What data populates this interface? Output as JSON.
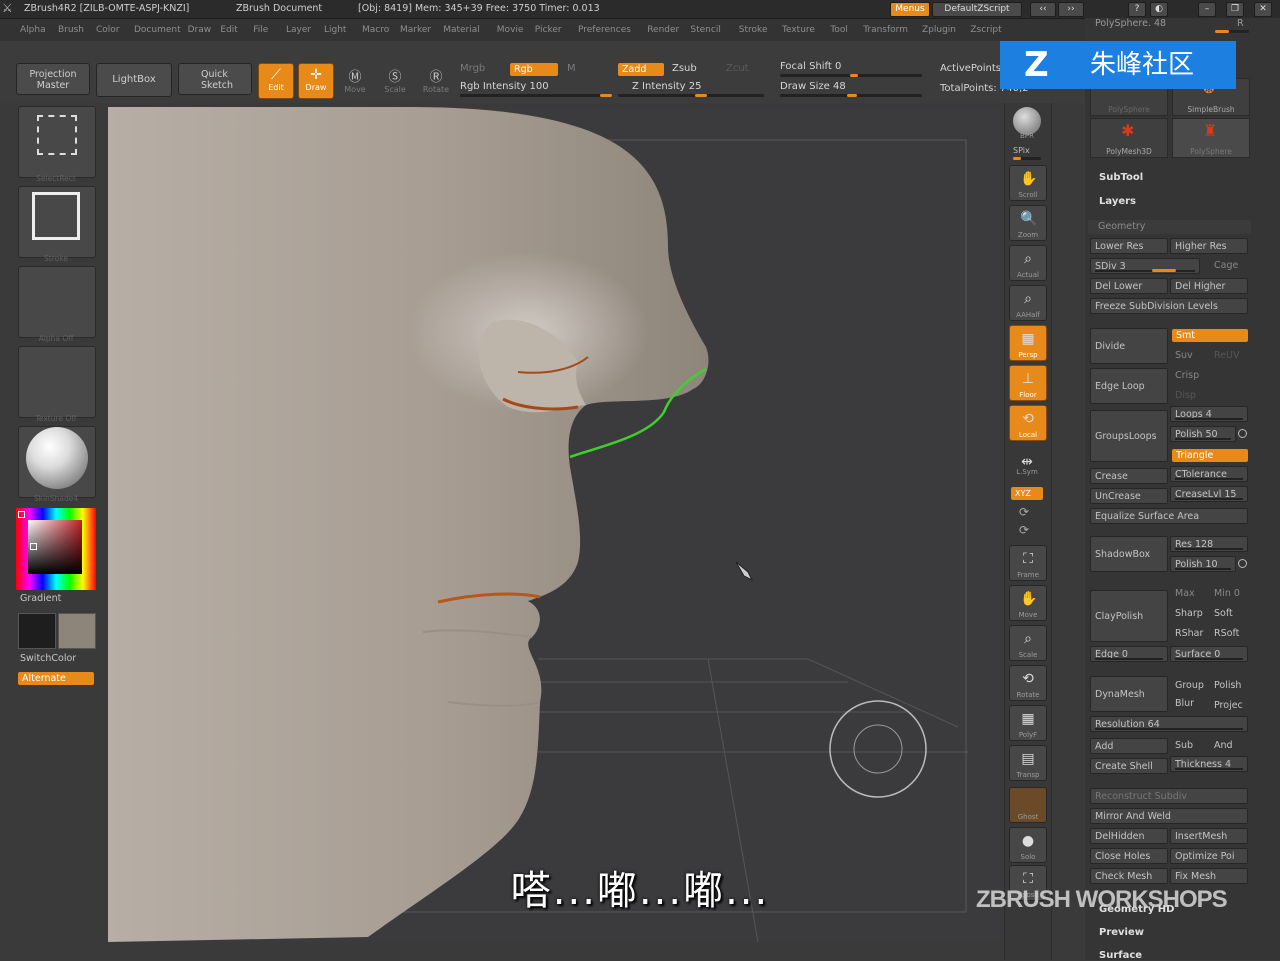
{
  "titlebar": {
    "app": "ZBrush4R2 [ZILB-OMTE-ASPJ-KNZI]",
    "doc": "ZBrush Document",
    "stats": "[Obj: 8419] Mem: 345+39 Free: 3750 Timer: 0.013",
    "menus_btn": "Menus",
    "script_btn": "DefaultZScript"
  },
  "menubar": [
    "Alpha",
    "Brush",
    "Color",
    "Document",
    "Draw",
    "Edit",
    "File",
    "Layer",
    "Light",
    "Macro",
    "Marker",
    "Material",
    "Movie",
    "Picker",
    "Preferences",
    "Render",
    "Stencil",
    "Stroke",
    "Texture",
    "Tool",
    "Transform",
    "Zplugin",
    "Zscript"
  ],
  "shelf": {
    "projection_master": "Projection Master",
    "lightbox": "LightBox",
    "quick_sketch": "Quick Sketch",
    "edit": "Edit",
    "draw": "Draw",
    "move": "Move",
    "scale": "Scale",
    "rotate": "Rotate",
    "mrgb": "Mrgb",
    "rgb": "Rgb",
    "m": "M",
    "rgb_intensity": "Rgb Intensity 100",
    "rgb_intensity_value": 100,
    "zadd": "Zadd",
    "zsub": "Zsub",
    "zcut": "Zcut",
    "z_intensity": "Z Intensity 25",
    "z_intensity_value": 25,
    "focal_shift": "Focal Shift 0",
    "draw_size": "Draw Size 48",
    "draw_size_value": 48,
    "active_points": "ActivePoints",
    "total_points": "TotalPoints: 740,2"
  },
  "lefttray": {
    "slot_labels": [
      "SelectRect",
      "Stroke",
      "Alpha Off",
      "Texture Off",
      "SkinShade4"
    ],
    "gradient": "Gradient",
    "switchcolor": "SwitchColor",
    "alternate": "Alternate",
    "primary_color": "#1e1e1e",
    "secondary_color": "#8e857a"
  },
  "righttool": {
    "buttons": [
      "BPR",
      "SPix",
      "Scroll",
      "Zoom",
      "Actual",
      "AAHalf",
      "Persp",
      "Floor",
      "Local",
      "L.Sym",
      "Frame",
      "Move",
      "Scale",
      "Rotate",
      "PolyF",
      "Transp",
      "Ghost",
      "Solo",
      "Xpose"
    ],
    "xyz": "XYZ"
  },
  "rpanel": {
    "top_label": "PolySphere. 48",
    "r": "R",
    "tool_thumbs": [
      "PolySphere",
      "SimpleBrush",
      "PolyMesh3D",
      "PolySphere"
    ],
    "subtool": "SubTool",
    "layers": "Layers",
    "geometry": "Geometry",
    "lower_res": "Lower Res",
    "higher_res": "Higher Res",
    "sdiv": "SDiv 3",
    "cage": "Cage",
    "del_lower": "Del Lower",
    "del_higher": "Del Higher",
    "freeze": "Freeze SubDivision Levels",
    "divide": "Divide",
    "smt": "Smt",
    "suv": "Suv",
    "reuv": "ReUV",
    "edge_loop": "Edge Loop",
    "crisp": "Crisp",
    "disp": "Disp",
    "groups_loops": "GroupsLoops",
    "loops": "Loops 4",
    "polish": "Polish 50",
    "triangle": "Triangle",
    "crease": "Crease",
    "ctolerance": "CTolerance",
    "uncrease": "UnCrease",
    "creaselvl": "CreaseLvl 15",
    "equalize": "Equalize Surface Area",
    "shadowbox": "ShadowBox",
    "res128": "Res 128",
    "polish10": "Polish 10",
    "claypolish": "ClayPolish",
    "max": "Max",
    "min0": "Min 0",
    "sharp": "Sharp",
    "soft": "Soft",
    "rsharp": "RShar",
    "rsoft": "RSoft",
    "edge0": "Edge 0",
    "surface0": "Surface 0",
    "dynamesh": "DynaMesh",
    "group": "Group",
    "polish_btn": "Polish",
    "blur": "Blur",
    "project": "Projec",
    "resolution": "Resolution 64",
    "add": "Add",
    "sub": "Sub",
    "and": "And",
    "create_shell": "Create Shell",
    "thickness": "Thickness 4",
    "reconstruct": "Reconstruct Subdiv",
    "mirror_weld": "Mirror And Weld",
    "delhidden": "DelHidden",
    "insertmesh": "InsertMesh",
    "close_holes": "Close Holes",
    "optimize": "Optimize Poi",
    "check_mesh": "Check Mesh",
    "fix_mesh": "Fix Mesh",
    "geometry_hd": "Geometry HD",
    "preview": "Preview",
    "surface": "Surface"
  },
  "watermark": {
    "cn": "朱峰社区",
    "ws": "ZBRUSH WORKSHOPS"
  },
  "subtitle": "嗒...嘟...嘟..."
}
